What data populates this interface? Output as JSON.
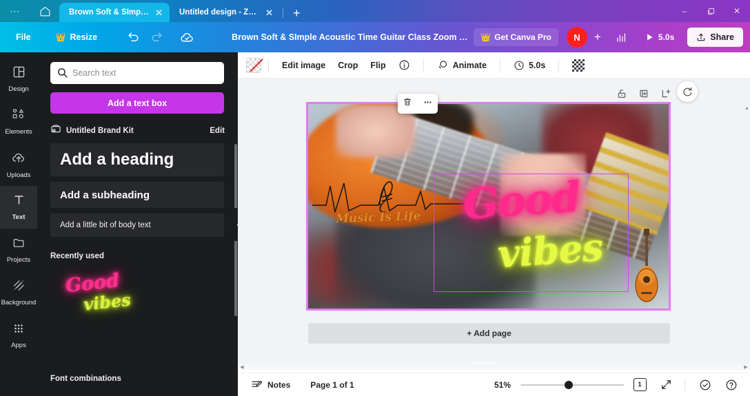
{
  "window": {
    "controls": {
      "minimize": "–",
      "maximize": "❐",
      "close": "✕"
    },
    "app_menu_icon": "more-dots-icon",
    "home_icon": "home-icon"
  },
  "tabs": {
    "items": [
      {
        "label": "Brown Soft & SImple A...",
        "active": true,
        "close": "✕"
      },
      {
        "label": "Untitled design - Zoo...",
        "active": false,
        "close": "✕"
      }
    ],
    "new_tab_label": "+"
  },
  "toolbar": {
    "file_label": "File",
    "resize_label": "Resize",
    "resize_badge": "👑",
    "undo_icon": "undo-icon",
    "redo_icon": "redo-icon",
    "cloud_saved_icon": "cloud-saved-icon",
    "doc_title": "Brown Soft & SImple Acoustic Time Guitar Class Zoom Virtu...",
    "pro_label": "Get Canva Pro",
    "pro_badge": "👑",
    "avatar_initial": "N",
    "avatar_color": "#ff1f1f",
    "add_collaborator_label": "+",
    "insights_icon": "bar-chart-icon",
    "present_duration": "5.0s",
    "play_icon": "play-icon",
    "share_label": "Share",
    "share_icon": "share-upload-icon"
  },
  "rail": {
    "items": [
      {
        "label": "Design",
        "icon": "design-layout-icon",
        "active": false
      },
      {
        "label": "Elements",
        "icon": "shapes-icon",
        "active": false
      },
      {
        "label": "Uploads",
        "icon": "upload-cloud-icon",
        "active": false
      },
      {
        "label": "Text",
        "icon": "text-t-icon",
        "active": true
      },
      {
        "label": "Projects",
        "icon": "folder-icon",
        "active": false
      },
      {
        "label": "Background",
        "icon": "hatch-pattern-icon",
        "active": false
      },
      {
        "label": "Apps",
        "icon": "grid-dots-icon",
        "active": false
      }
    ]
  },
  "panel": {
    "search_placeholder": "Search text",
    "search_value": "",
    "add_text_box_label": "Add a text box",
    "brand_kit_label": "Untitled Brand Kit",
    "brand_kit_edit_label": "Edit",
    "styles": [
      {
        "label": "Add a heading"
      },
      {
        "label": "Add a subheading"
      },
      {
        "label": "Add a little bit of body text"
      }
    ],
    "recently_used_label": "Recently used",
    "recent_item": {
      "line1": "Good",
      "line2": "vibes",
      "color1": "#ff2f8e",
      "color2": "#d9f23b"
    },
    "font_combinations_label": "Font combinations",
    "collapse_icon": "chevron-left-icon",
    "accent_color": "#c436e8"
  },
  "editor_toolbar": {
    "color_swatch_name": "no-color-swatch",
    "edit_image_label": "Edit image",
    "crop_label": "Crop",
    "flip_label": "Flip",
    "info_icon": "info-circle-icon",
    "animate_label": "Animate",
    "animate_icon": "animate-icon",
    "duration_label": "5.0s",
    "duration_icon": "clock-icon",
    "transparency_icon": "transparency-checker-icon"
  },
  "canvas": {
    "object_tools": [
      {
        "icon": "lock-icon",
        "name": "lock-object"
      },
      {
        "icon": "duplicate-icon",
        "name": "duplicate-object"
      },
      {
        "icon": "add-page-icon",
        "name": "add-page-after"
      }
    ],
    "floating_toolbar": [
      {
        "icon": "trash-icon",
        "name": "delete-object"
      },
      {
        "icon": "more-dots-icon",
        "name": "more-options"
      }
    ],
    "rotate_icon": "rotate-icon",
    "selection_color": "#d04ae8",
    "page_border_color": "#e07cf0",
    "design_text": {
      "tagline": "Music Is Life",
      "tagline_color": "#e08a22",
      "neon_line1": "Good",
      "neon_line2": "vibes",
      "neon_color1": "#ff2a8c",
      "neon_color2": "#e4fa45"
    },
    "add_page_label": "+ Add page",
    "collapse_pages_icon": "chevron-up-icon"
  },
  "status": {
    "notes_label": "Notes",
    "notes_icon": "notes-icon",
    "page_indicator": "Page 1 of 1",
    "zoom_level": "51%",
    "page_count": "1",
    "pages_icon": "pages-icon",
    "fullscreen_icon": "expand-icon",
    "help_check_icon": "check-circle-icon",
    "help_icon": "question-circle-icon"
  }
}
